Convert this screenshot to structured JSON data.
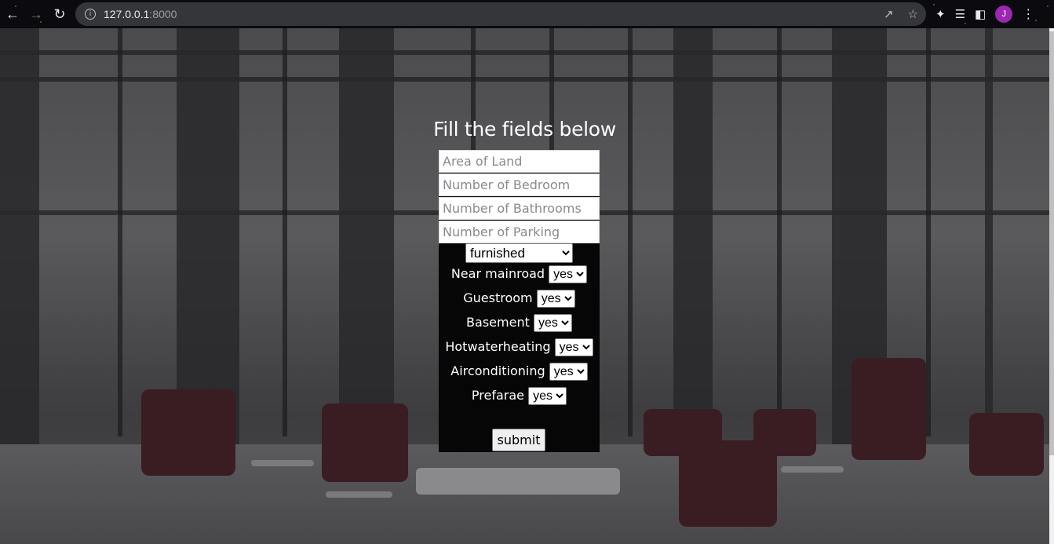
{
  "browser": {
    "url_host": "127.0.0.1",
    "url_port": ":8000",
    "avatar_letter": "J"
  },
  "page": {
    "title": "Fill the fields below",
    "inputs": {
      "area_placeholder": "Area of Land",
      "bedroom_placeholder": "Number of Bedroom",
      "bathrooms_placeholder": "Number of Bathrooms",
      "parking_placeholder": "Number of Parking"
    },
    "furnishing_selected": "furnished",
    "rows": [
      {
        "label": "Near mainroad",
        "selected": "yes"
      },
      {
        "label": "Guestroom",
        "selected": "yes"
      },
      {
        "label": "Basement",
        "selected": "yes"
      },
      {
        "label": "Hotwaterheating",
        "selected": "yes"
      },
      {
        "label": "Airconditioning",
        "selected": "yes"
      },
      {
        "label": "Prefarae",
        "selected": "yes"
      }
    ],
    "submit_label": "submit"
  }
}
